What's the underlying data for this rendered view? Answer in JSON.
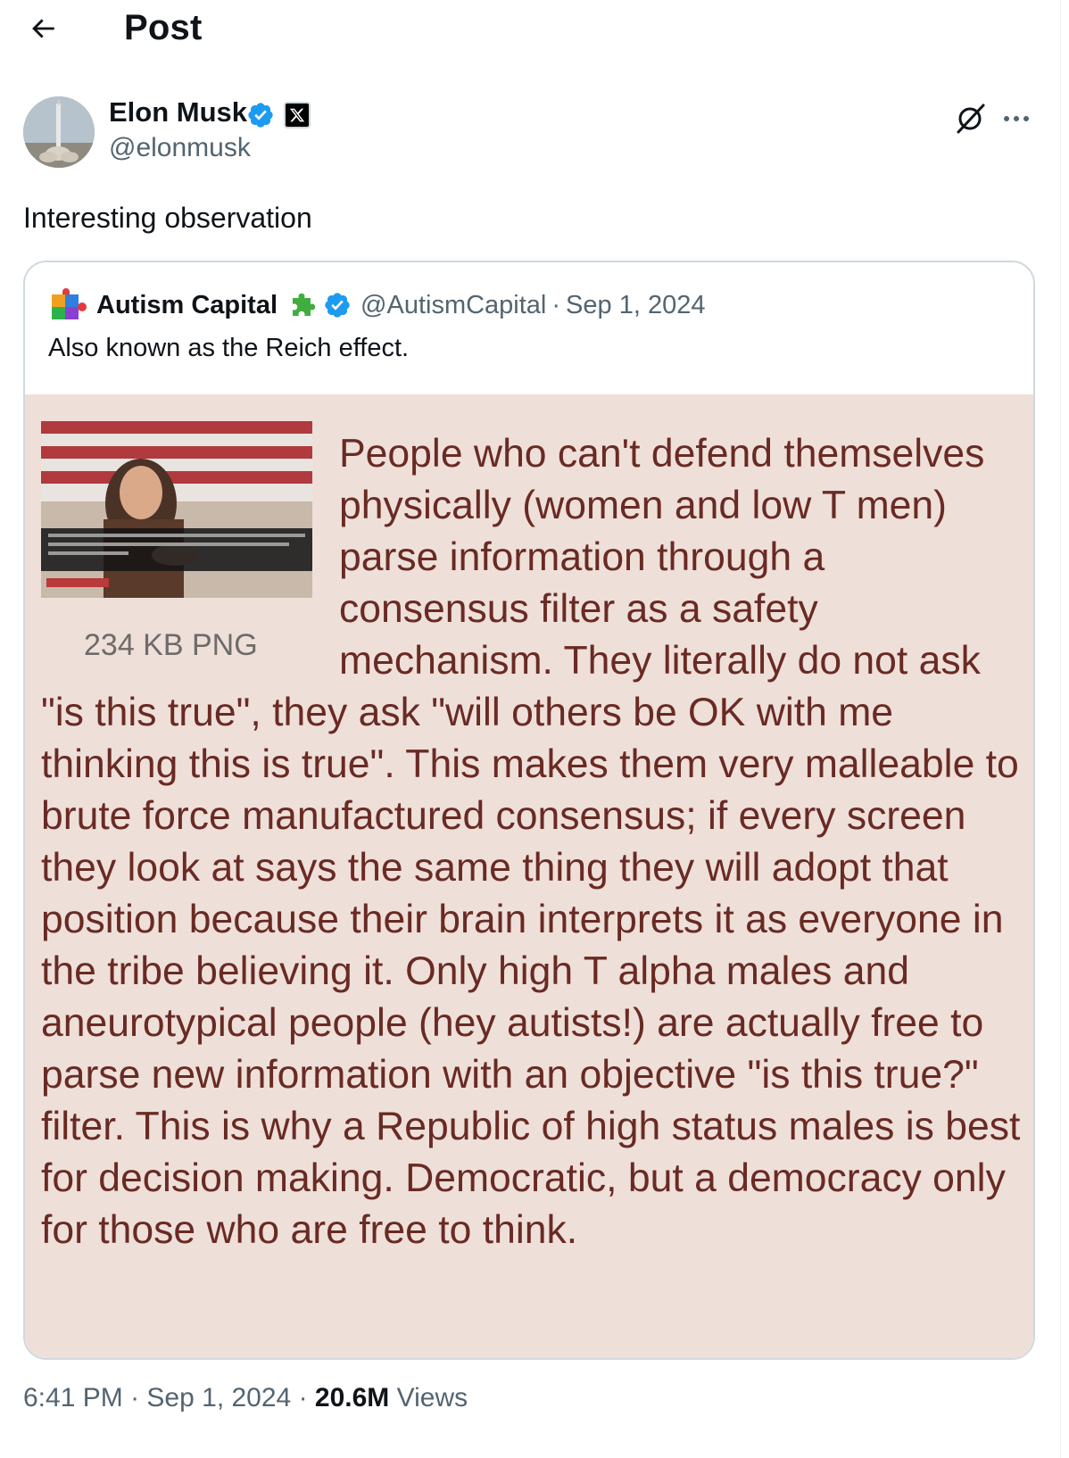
{
  "header": {
    "back_icon": "arrow-left-icon",
    "title": "Post"
  },
  "author": {
    "name": "Elon Musk",
    "handle": "@elonmusk",
    "verified": true,
    "badge_icon": "x-logo-icon",
    "avatar_icon": "rocket-launch-avatar"
  },
  "actions": {
    "grok_icon": "grok-icon",
    "more_icon": "more-horizontal-icon"
  },
  "post": {
    "text": "Interesting observation"
  },
  "quote": {
    "name": "Autism Capital",
    "handle": "@AutismCapital",
    "separator": "·",
    "date": "Sep 1, 2024",
    "text": "Also known as the Reich effect.",
    "image": {
      "file_info": "234 KB PNG",
      "text": "People who can't defend themselves physically (women and low T men) parse information through a consensus filter as a safety mechanism. They literally do not ask \"is this true\", they ask \"will others be OK with me thinking this is true\". This makes them very malleable to brute force manufactured consensus; if every screen they look at says the same thing they will adopt that position because their brain interprets it as everyone in the tribe believing it. Only high T alpha males and aneurotypical people (hey autists!) are actually free to parse new information with an objective \"is this true?\" filter. This is why a Republic of high status males is best for decision making. Democratic, but a democracy only for those who are free to think."
    }
  },
  "meta": {
    "time": "6:41 PM",
    "sep1": "·",
    "date": "Sep 1, 2024",
    "sep2": "·",
    "views_count": "20.6M",
    "views_label": "Views"
  },
  "colors": {
    "text_primary": "#0f1419",
    "text_secondary": "#536471",
    "verified_blue": "#1d9bf0",
    "border": "#cfd9de",
    "image_bg": "#eee0d9",
    "image_text": "#6a2a24"
  }
}
